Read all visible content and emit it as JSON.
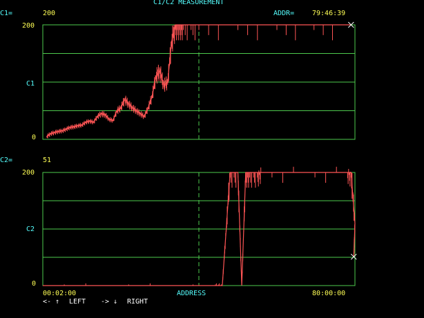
{
  "title": "C1/C2 MEASUREMENT",
  "readout": {
    "c1_label": "C1=",
    "c1_value": "200",
    "c2_label": "C2=",
    "c2_value": "51",
    "addr_label": "ADDR=",
    "addr_value": "79:46:39"
  },
  "plot_top": {
    "y_max": "200",
    "y_mid": "C1",
    "y_min": "0"
  },
  "plot_bottom": {
    "y_max": "200",
    "y_mid": "C2",
    "y_min": "0"
  },
  "x_axis": {
    "start": "00:02:00",
    "label": "ADDRESS",
    "end": "80:00:00"
  },
  "controls": {
    "left_keys": "<- ↑",
    "left_label": "LEFT",
    "right_keys": "-> ↓",
    "right_label": "RIGHT"
  },
  "colors": {
    "grid": "#4ecb4e",
    "trace": "#ff5555",
    "cursor": "#4ecb4e",
    "label": "#55ffff",
    "value": "#ffff55"
  },
  "chart_data": [
    {
      "type": "line",
      "series": [
        {
          "values": [
            [
              1,
              5
            ],
            [
              2,
              10
            ],
            [
              3,
              12
            ],
            [
              4,
              14
            ],
            [
              5,
              15
            ],
            [
              6,
              18
            ],
            [
              7,
              21
            ],
            [
              8,
              22
            ],
            [
              9,
              24
            ],
            [
              10,
              25
            ],
            [
              11,
              30
            ],
            [
              12,
              32
            ],
            [
              13,
              30
            ],
            [
              14,
              40
            ],
            [
              15,
              45
            ],
            [
              16,
              43
            ],
            [
              17,
              35
            ],
            [
              18,
              33
            ],
            [
              19,
              50
            ],
            [
              20,
              55
            ],
            [
              21,
              70
            ],
            [
              22,
              62
            ],
            [
              23,
              55
            ],
            [
              24,
              50
            ],
            [
              25,
              45
            ],
            [
              26,
              40
            ],
            [
              27,
              55
            ],
            [
              28,
              75
            ],
            [
              29,
              110
            ],
            [
              30,
              120
            ],
            [
              31,
              95
            ],
            [
              32,
              100
            ],
            [
              33,
              170
            ],
            [
              34,
              200
            ],
            [
              35,
              200
            ],
            [
              36,
              200
            ],
            [
              40,
              200
            ],
            [
              60,
              200
            ],
            [
              79,
              200
            ]
          ]
        }
      ],
      "xlim": [
        0,
        80
      ],
      "ylim": [
        0,
        200
      ],
      "cursor_x": 40,
      "cursor_y": 200
    },
    {
      "type": "line",
      "series": [
        {
          "values": [
            [
              0,
              0
            ],
            [
              44,
              0
            ],
            [
              46,
              0
            ],
            [
              47,
              100
            ],
            [
              48,
              200
            ],
            [
              50,
              200
            ],
            [
              51,
              0
            ],
            [
              52,
              200
            ],
            [
              53,
              200
            ],
            [
              55,
              200
            ],
            [
              56,
              210
            ],
            [
              78,
              210
            ],
            [
              79,
              200
            ],
            [
              80,
              110
            ],
            [
              79.7,
              51
            ]
          ]
        }
      ],
      "xlim": [
        0,
        80
      ],
      "ylim": [
        0,
        200
      ],
      "cursor_x": 40,
      "cursor_y": 51
    }
  ]
}
